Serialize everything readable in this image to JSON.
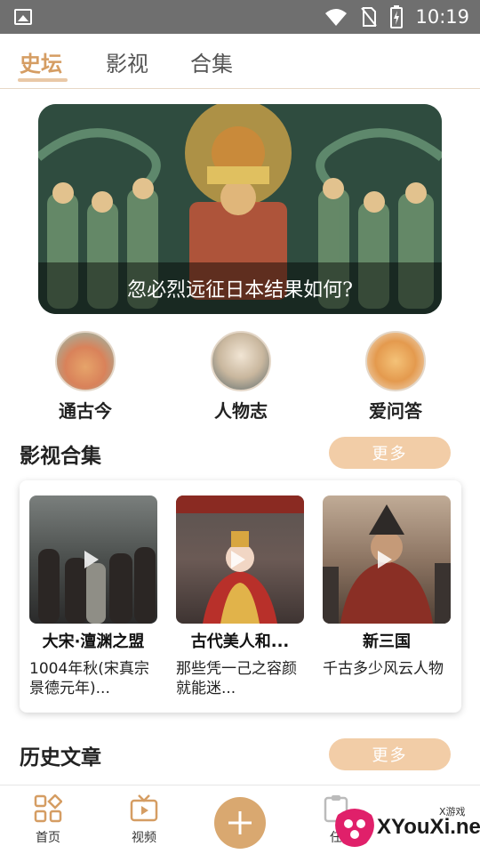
{
  "status_bar": {
    "time": "10:19"
  },
  "top_tabs": [
    {
      "label": "史坛",
      "active": true
    },
    {
      "label": "影视",
      "active": false
    },
    {
      "label": "合集",
      "active": false
    }
  ],
  "banner": {
    "caption": "忽必烈远征日本结果如何?"
  },
  "categories": [
    {
      "label": "通古今"
    },
    {
      "label": "人物志"
    },
    {
      "label": "爱问答"
    }
  ],
  "video_section": {
    "title": "影视合集",
    "more_label": "更多",
    "cards": [
      {
        "title": "大宋·澶渊之盟",
        "desc": "1004年秋(宋真宗景德元年)..."
      },
      {
        "title": "古代美人和...",
        "desc": "那些凭一己之容颜就能迷..."
      },
      {
        "title": "新三国",
        "desc": "千古多少风云人物"
      }
    ]
  },
  "articles_section": {
    "title": "历史文章",
    "more_label": "更多"
  },
  "bottom_nav": [
    {
      "label": "首页"
    },
    {
      "label": "视频"
    },
    {
      "label": "任"
    }
  ],
  "watermark": {
    "main": "XYouXi.net",
    "small": "X游戏"
  },
  "colors": {
    "accent": "#d59d63",
    "button": "#f2cda7",
    "fab": "#d9a870"
  }
}
